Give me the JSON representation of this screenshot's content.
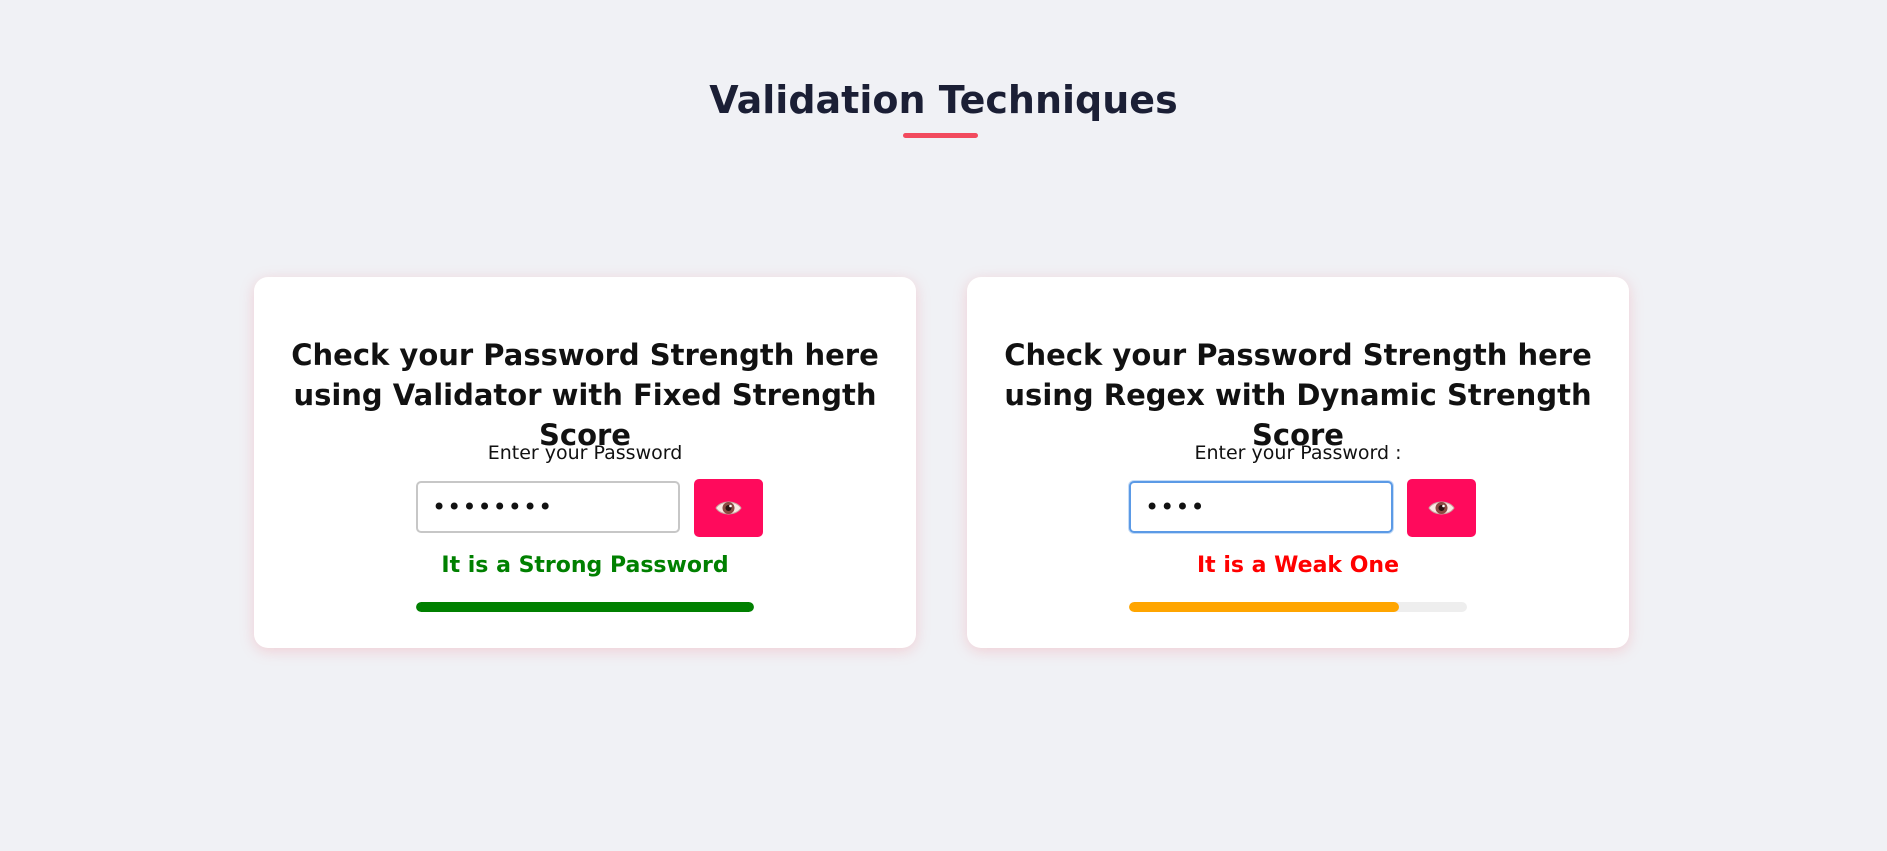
{
  "page": {
    "title": "Validation Techniques",
    "accent_color": "#f24a5e"
  },
  "cards": [
    {
      "heading": "Check your Password Strength here using Validator with Fixed Strength Score",
      "label": "Enter your Password",
      "password_masked": "••••••••",
      "toggle_icon": "eye-icon",
      "status": "It is a Strong Password",
      "status_color": "#008000",
      "strength_fraction": 1.0,
      "meter_color": "#008000",
      "input_focused": false
    },
    {
      "heading": "Check your Password Strength here using Regex with Dynamic Strength Score",
      "label": "Enter your Password :",
      "password_masked": "••••",
      "toggle_icon": "eye-icon",
      "status": "It is a Weak One",
      "status_color": "#ff0000",
      "strength_fraction": 0.8,
      "meter_color": "#ffa500",
      "input_focused": true
    }
  ],
  "colors": {
    "button": "#ff0a5c",
    "background": "#f0f1f5",
    "title": "#1b1f35"
  }
}
